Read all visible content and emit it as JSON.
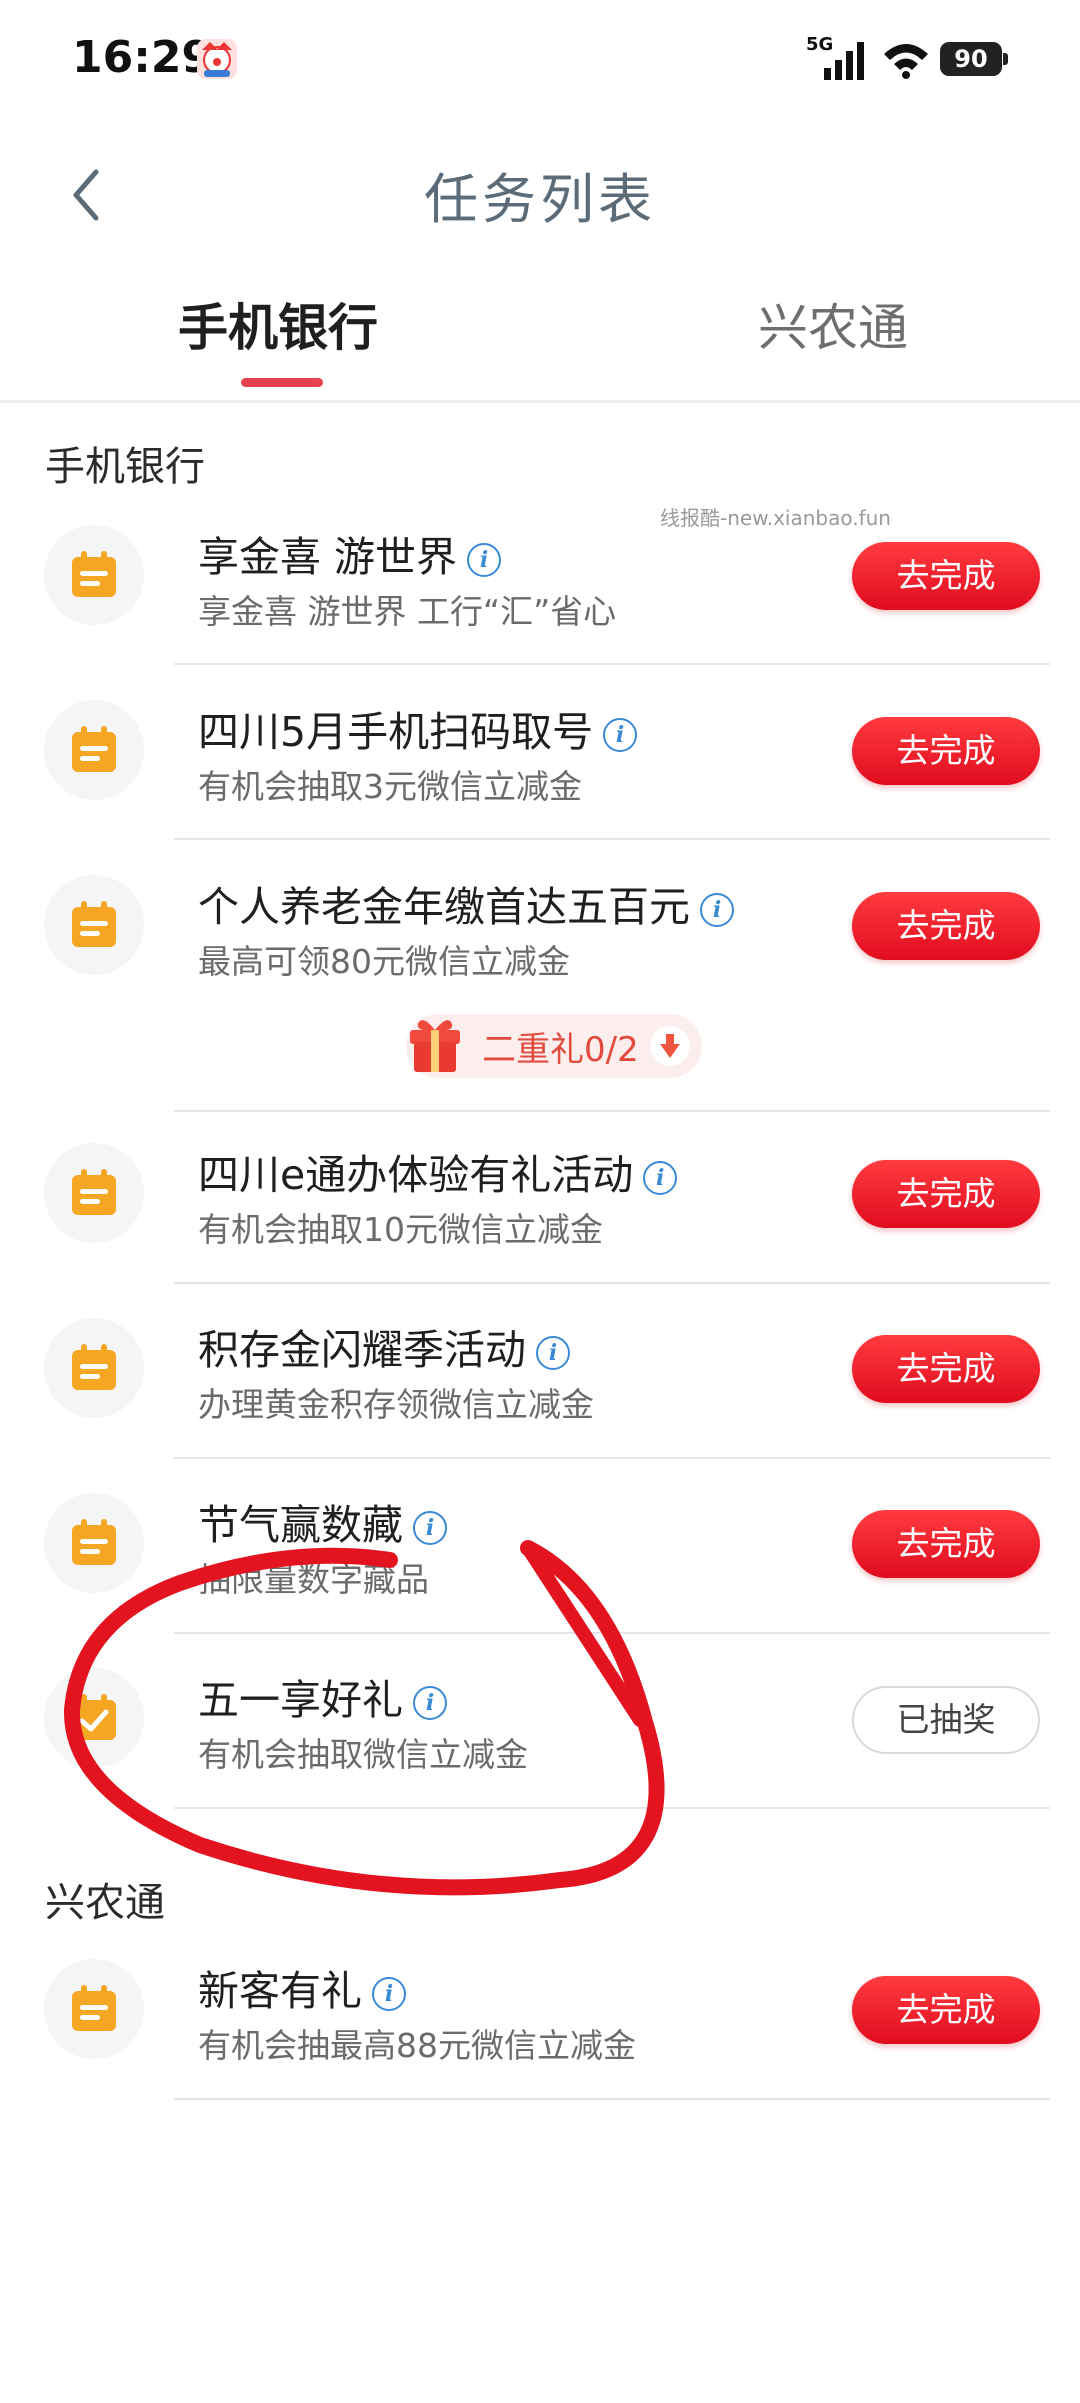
{
  "status_bar": {
    "time": "16:29",
    "network": "5G",
    "battery": "90"
  },
  "header": {
    "title": "任务列表"
  },
  "tabs": [
    {
      "label": "手机银行",
      "active": true
    },
    {
      "label": "兴农通",
      "active": false
    }
  ],
  "watermark": "线报酷-new.xianbao.fun",
  "sections": [
    {
      "title": "手机银行",
      "tasks": [
        {
          "title": "享金喜 游世界",
          "subtitle": "享金喜 游世界 工行“汇”省心",
          "button": "去完成"
        },
        {
          "title": "四川5月手机扫码取号",
          "subtitle": "有机会抽取3元微信立减金",
          "button": "去完成"
        },
        {
          "title": "个人养老金年缴首达五百元",
          "subtitle": "最高可领80元微信立减金",
          "button": "去完成",
          "badge": "二重礼0/2"
        },
        {
          "title": "四川e通办体验有礼活动",
          "subtitle": "有机会抽取10元微信立减金",
          "button": "去完成"
        },
        {
          "title": "积存金闪耀季活动",
          "subtitle": "办理黄金积存领微信立减金",
          "button": "去完成"
        },
        {
          "title": "节气赢数藏",
          "subtitle": "抽限量数字藏品",
          "button": "去完成"
        },
        {
          "title": "五一享好礼",
          "subtitle": "有机会抽取微信立减金",
          "button": "已抽奖"
        }
      ]
    },
    {
      "title": "兴农通",
      "tasks": [
        {
          "title": "新客有礼",
          "subtitle": "有机会抽最高88元微信立减金",
          "button": "去完成"
        }
      ]
    }
  ],
  "colors": {
    "accent": "#e8414f",
    "button_red": "#e10c1f",
    "icon_orange": "#f5a623",
    "info_blue": "#3a8ad6",
    "annotation_red": "#e3131f"
  }
}
